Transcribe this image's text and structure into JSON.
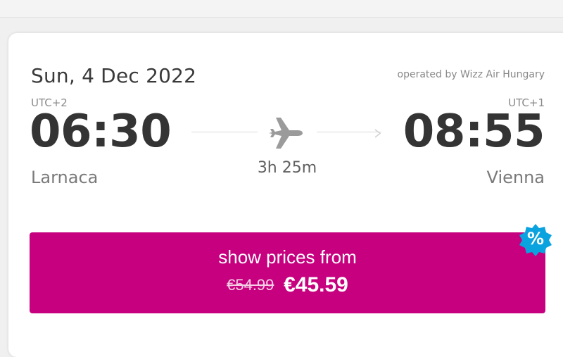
{
  "flight": {
    "date": "Sun, 4 Dec 2022",
    "operator": "operated by Wizz Air Hungary",
    "departure": {
      "timezone": "UTC+2",
      "time": "06:30",
      "city": "Larnaca"
    },
    "arrival": {
      "timezone": "UTC+1",
      "time": "08:55",
      "city": "Vienna"
    },
    "duration": "3h 25m"
  },
  "pricing": {
    "label": "show prices from",
    "old_price": "€54.99",
    "new_price": "€45.59",
    "badge": "%"
  },
  "icons": {
    "plane": "plane-icon",
    "arrow": "arrow-right-icon",
    "discount": "discount-badge-icon"
  },
  "colors": {
    "brand": "#c6007e",
    "badge": "#0aa3df",
    "text_dark": "#343434",
    "text_muted": "#7a7a7a"
  }
}
